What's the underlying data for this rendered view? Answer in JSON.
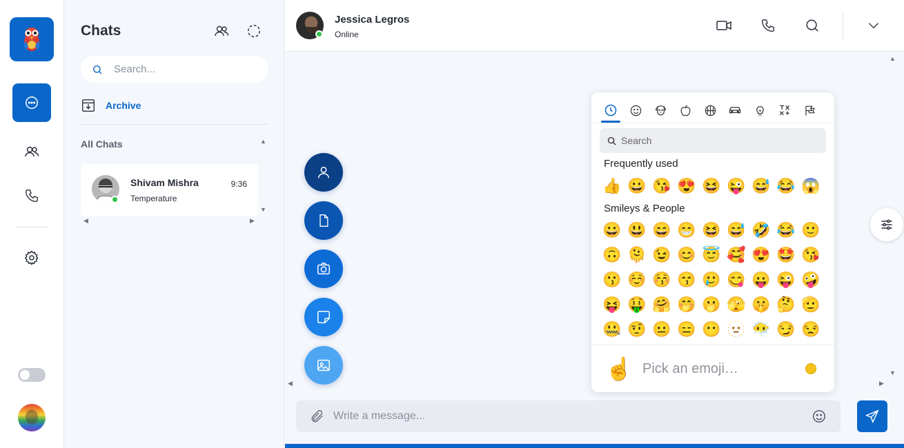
{
  "colors": {
    "accent": "#0a67c9",
    "online": "#33c24a"
  },
  "rail": {
    "items": [
      {
        "name": "chats",
        "icon": "chat-bubble-icon",
        "active": true
      },
      {
        "name": "contacts",
        "icon": "users-icon",
        "active": false
      },
      {
        "name": "calls",
        "icon": "phone-icon",
        "active": false
      },
      {
        "name": "settings",
        "icon": "gear-icon",
        "active": false
      }
    ]
  },
  "chats": {
    "title": "Chats",
    "search_placeholder": "Search...",
    "archive_label": "Archive",
    "section_label": "All Chats",
    "items": [
      {
        "name": "Shivam Mishra",
        "time": "9:36",
        "last_message": "Temperature",
        "online": true
      }
    ]
  },
  "conversation": {
    "contact_name": "Jessica Legros",
    "contact_status": "Online",
    "composer_placeholder": "Write a message..."
  },
  "attach_menu": [
    {
      "icon": "user-icon",
      "color": "#0b3f86"
    },
    {
      "icon": "document-icon",
      "color": "#0a56b2"
    },
    {
      "icon": "camera-icon",
      "color": "#0d6bd6"
    },
    {
      "icon": "sticker-icon",
      "color": "#1a82ea"
    },
    {
      "icon": "image-icon",
      "color": "#4ea6f2"
    }
  ],
  "emoji_picker": {
    "search_placeholder": "Search",
    "frequent_label": "Frequently used",
    "smileys_label": "Smileys & People",
    "frequent": [
      "👍",
      "😀",
      "😘",
      "😍",
      "😆",
      "😜",
      "😅",
      "😂",
      "😱"
    ],
    "smileys": [
      [
        "😀",
        "😃",
        "😄",
        "😁",
        "😆",
        "😅",
        "🤣",
        "😂",
        "🙂"
      ],
      [
        "🙃",
        "🫠",
        "😉",
        "😊",
        "😇",
        "🥰",
        "😍",
        "🤩",
        "😘"
      ],
      [
        "😗",
        "☺️",
        "😚",
        "😙",
        "🥲",
        "😋",
        "😛",
        "😜",
        "🤪"
      ],
      [
        "😝",
        "🤑",
        "🤗",
        "🤭",
        "🫢",
        "🫣",
        "🤫",
        "🤔",
        "🫡"
      ],
      [
        "🤐",
        "🤨",
        "😐",
        "😑",
        "😶",
        "🫥",
        "😶‍🌫️",
        "😏",
        "😒"
      ]
    ],
    "preview_emoji": "☝️",
    "preview_text": "Pick an emoji…"
  }
}
